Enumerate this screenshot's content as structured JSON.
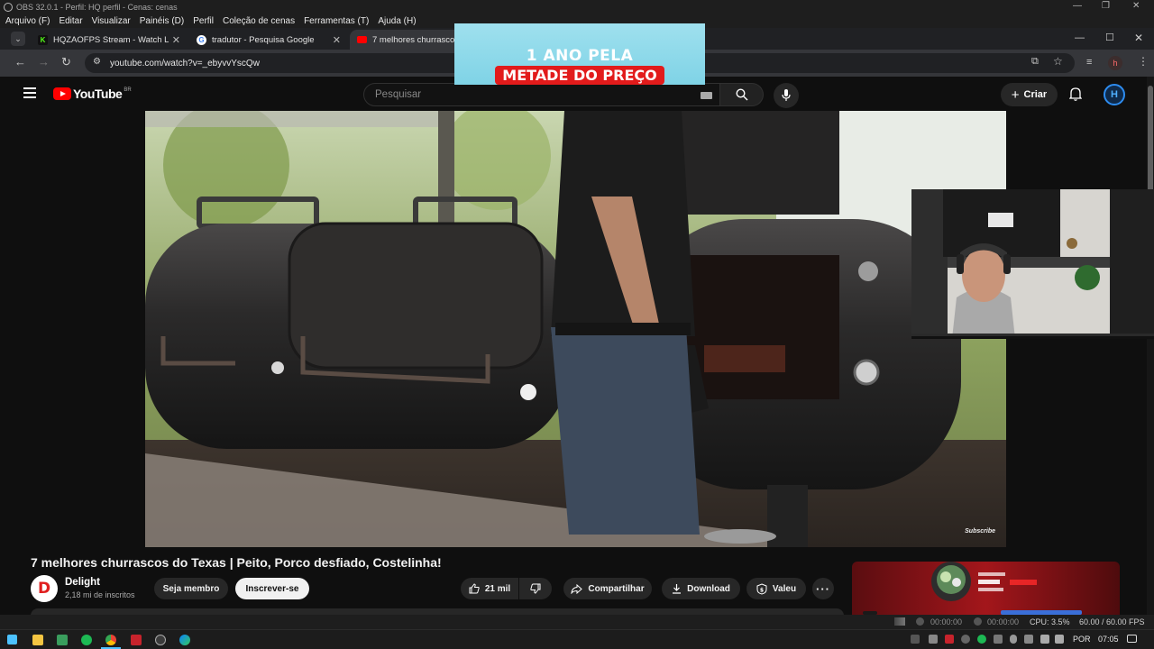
{
  "obs": {
    "title": "OBS 32.0.1 - Perfil: HQ perfil - Cenas: cenas",
    "menu": [
      "Arquivo (F)",
      "Editar",
      "Visualizar",
      "Painéis (D)",
      "Perfil",
      "Coleção de cenas",
      "Ferramentas (T)",
      "Ajuda (H)"
    ],
    "status": {
      "rec_time": "00:00:00",
      "stream_time": "00:00:00",
      "cpu": "CPU: 3.5%",
      "fps": "60.00 / 60.00 FPS"
    }
  },
  "browser": {
    "tabs": [
      {
        "label": "HQZAOFPS Stream - Watch Live",
        "favicon": "kick-icon"
      },
      {
        "label": "tradutor - Pesquisa Google",
        "favicon": "google-icon"
      },
      {
        "label": "7 melhores churrascos d",
        "favicon": "youtube-icon"
      }
    ],
    "url": "youtube.com/watch?v=_ebyvvYscQw",
    "profile_initial": "h"
  },
  "ad_banner": {
    "line1": "1 ANO PELA",
    "line2": "METADE DO PREÇO"
  },
  "youtube": {
    "logo_text": "YouTube",
    "country_code": "BR",
    "search_placeholder": "Pesquisar",
    "create_label": "Criar",
    "avatar_initial": "H",
    "video": {
      "title": "7 melhores churrascos do Texas | Peito, Porco desfiado, Costelinha!",
      "watermark": "Subscribe"
    },
    "channel": {
      "initial": "D",
      "name": "Delight",
      "subscribers": "2,18 mi de inscritos"
    },
    "buttons": {
      "join": "Seja membro",
      "subscribe": "Inscrever-se",
      "likes": "21 mil",
      "share": "Compartilhar",
      "download": "Download",
      "thanks": "Valeu"
    }
  },
  "taskbar": {
    "language": "POR",
    "time": "07:05"
  },
  "colors": {
    "youtube_red": "#ff0000",
    "ad_red": "#e21b1b",
    "ad_sky": "#8fdaea",
    "page_bg": "#0f0f0f"
  }
}
